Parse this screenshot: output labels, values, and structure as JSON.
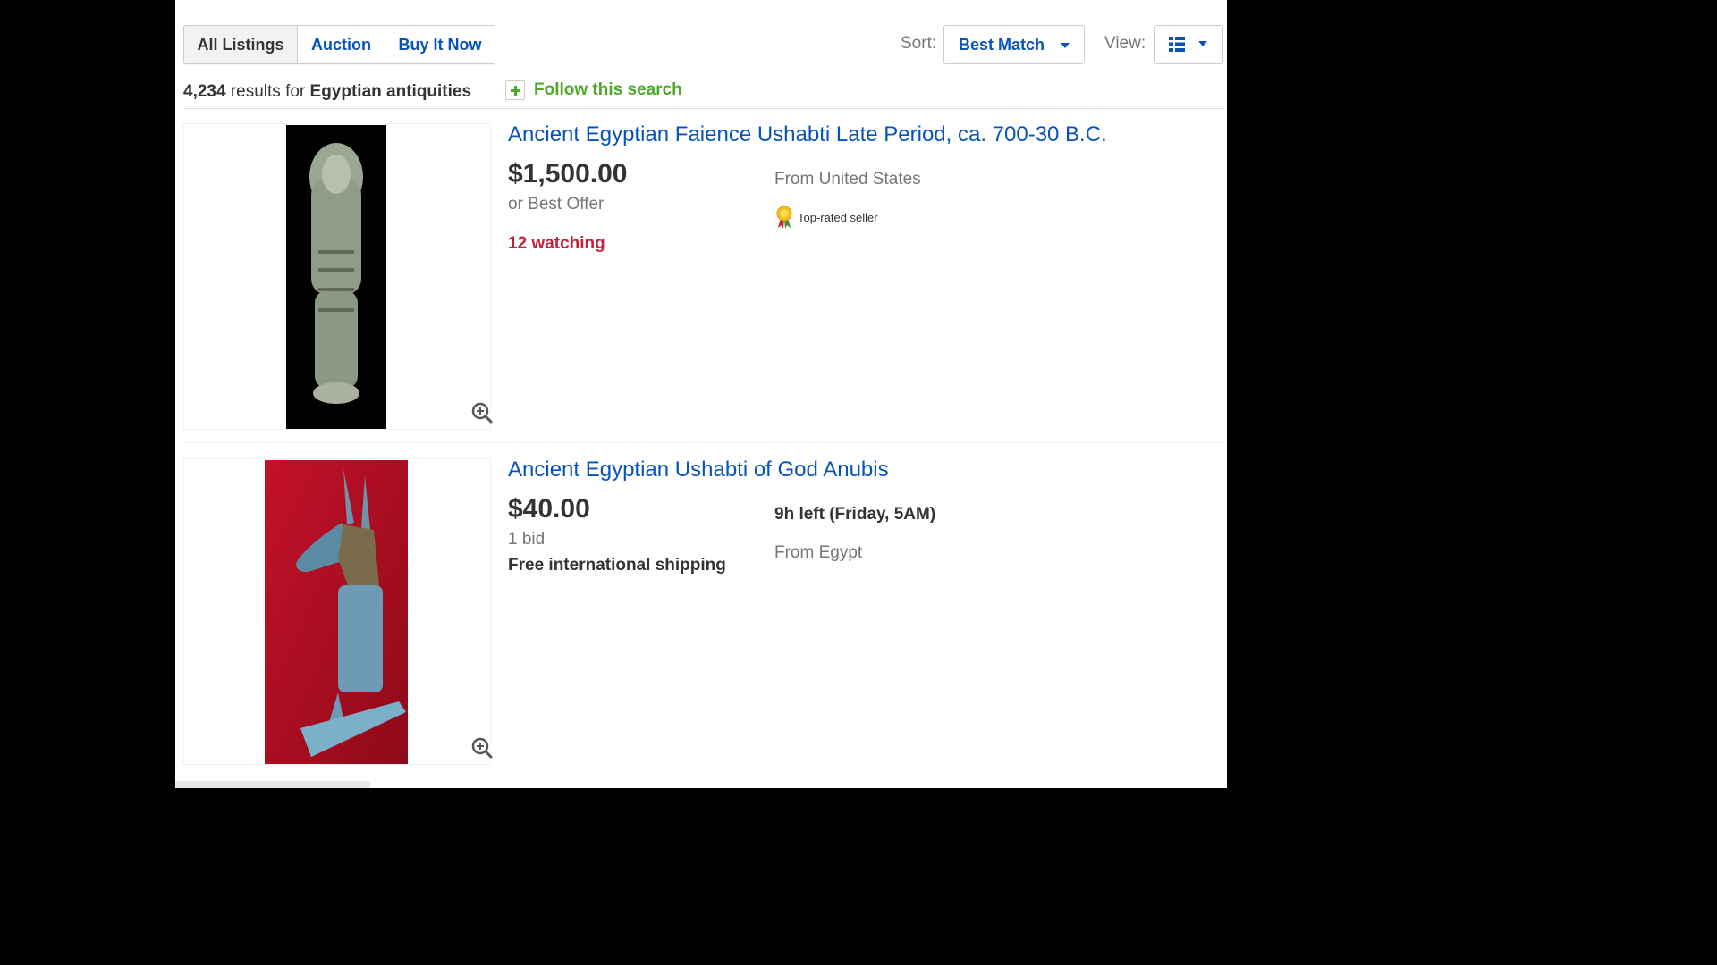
{
  "tabs": {
    "all_listings": "All Listings",
    "auction": "Auction",
    "buy_it_now": "Buy It Now"
  },
  "sort": {
    "label": "Sort:",
    "value": "Best Match"
  },
  "view": {
    "label": "View:",
    "icon": "list-view-icon"
  },
  "results": {
    "count": "4,234",
    "for_text": "results for",
    "query": "Egyptian antiquities"
  },
  "follow": {
    "label": "Follow this search",
    "icon": "plus-icon"
  },
  "listings": [
    {
      "title": "Ancient Egyptian Faience Ushabti Late Period, ca. 700-30 B.C.",
      "price": "$1,500.00",
      "format": "or Best Offer",
      "watching": "12 watching",
      "location": "From United States",
      "badge": "Top-rated seller"
    },
    {
      "title": "Ancient Egyptian Ushabti of God Anubis",
      "price": "$40.00",
      "bids": "1 bid",
      "shipping": "Free international shipping",
      "time_left": "9h left (Friday, 5AM)",
      "location": "From Egypt"
    }
  ],
  "colors": {
    "link": "#0654ba",
    "follow": "#4ea82a",
    "watching": "#c4213c",
    "text": "#333333",
    "muted": "#767676"
  }
}
